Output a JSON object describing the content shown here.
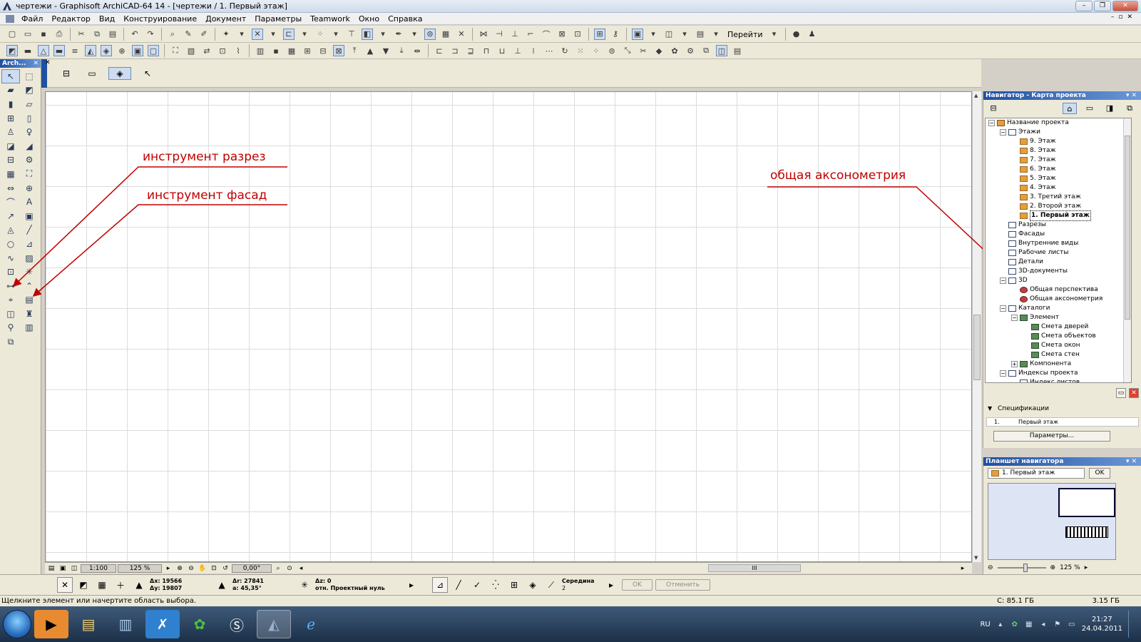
{
  "window": {
    "title": "чертежи - Graphisoft ArchiCAD-64 14 - [чертежи / 1. Первый этаж]",
    "controls": [
      "–",
      "❐",
      "✕"
    ]
  },
  "menu": {
    "items": [
      "Файл",
      "Редактор",
      "Вид",
      "Конструирование",
      "Документ",
      "Параметры",
      "Teamwork",
      "Окно",
      "Справка"
    ]
  },
  "toolbar": {
    "goto_label": "Перейти"
  },
  "toolbox": {
    "title": "Arch...",
    "tools": [
      {
        "name": "arrow-tool",
        "glyph": "↖"
      },
      {
        "name": "marquee-tool",
        "glyph": "⬚"
      },
      {
        "name": "wall-tool",
        "glyph": "▰"
      },
      {
        "name": "beam-tool",
        "glyph": "◩"
      },
      {
        "name": "column-tool",
        "glyph": "▮"
      },
      {
        "name": "slab-tool",
        "glyph": "▱"
      },
      {
        "name": "window-tool",
        "glyph": "⊞"
      },
      {
        "name": "door-tool",
        "glyph": "▯"
      },
      {
        "name": "object-tool",
        "glyph": "♙"
      },
      {
        "name": "lamp-tool",
        "glyph": "♀"
      },
      {
        "name": "roof-tool",
        "glyph": "◪"
      },
      {
        "name": "shell-tool",
        "glyph": "◢"
      },
      {
        "name": "stair-tool",
        "glyph": "⊟"
      },
      {
        "name": "railing-tool",
        "glyph": "⚙"
      },
      {
        "name": "mesh-tool",
        "glyph": "▦"
      },
      {
        "name": "zone-tool",
        "glyph": "⛶"
      },
      {
        "name": "dimension-tool",
        "glyph": "⇔"
      },
      {
        "name": "level-dimension-tool",
        "glyph": "⊕"
      },
      {
        "name": "radial-dimension-tool",
        "glyph": "⌒"
      },
      {
        "name": "text-tool",
        "glyph": "A"
      },
      {
        "name": "label-tool",
        "glyph": "↗"
      },
      {
        "name": "figure-tool",
        "glyph": "▣"
      },
      {
        "name": "fill-tool",
        "glyph": "◬"
      },
      {
        "name": "line-tool",
        "glyph": "╱"
      },
      {
        "name": "circle-tool",
        "glyph": "○"
      },
      {
        "name": "polyline-tool",
        "glyph": "⊿"
      },
      {
        "name": "spline-tool",
        "glyph": "∿"
      },
      {
        "name": "picture-tool",
        "glyph": "▨"
      },
      {
        "name": "detail-tool",
        "glyph": "⊡"
      },
      {
        "name": "hotspot-tool",
        "glyph": "✳"
      },
      {
        "name": "section-tool",
        "glyph": "⊶"
      },
      {
        "name": "elevation-tool",
        "glyph": "⌃"
      },
      {
        "name": "interior-elevation-tool",
        "glyph": "⌖"
      },
      {
        "name": "worksheet-tool",
        "glyph": "▤"
      },
      {
        "name": "change-tool",
        "glyph": "◫"
      },
      {
        "name": "camera-tool",
        "glyph": "♜"
      },
      {
        "name": "camera2-tool",
        "glyph": "⚲"
      },
      {
        "name": "grid-element-tool",
        "glyph": "▥"
      },
      {
        "name": "curtain-wall-tool",
        "glyph": "⧉"
      },
      {
        "name": "",
        "glyph": ""
      }
    ]
  },
  "annotations": {
    "section_tool": "инструмент разрез",
    "elevation_tool": "инструмент фасад",
    "axonometry": "общая аксонометрия"
  },
  "quickbar": {
    "scale": "1:100",
    "zoom": "125 %",
    "angle": "0,00°",
    "hscroll_mark": "III"
  },
  "coords": {
    "dx": "Δx: 19566",
    "dy": "Δy: 19807",
    "dr": "Δr: 27841",
    "a": "a: 45,35°",
    "dz": "Δz: 0",
    "ref": "отн. Проектный нуль",
    "snap_label": "Середина",
    "snap_value": "2",
    "ok": "OK",
    "cancel": "Отменить"
  },
  "status": {
    "message": "Щелкните элемент или начертите область выбора.",
    "disk": "С: 85.1 ГБ",
    "memory": "3.15 ГБ"
  },
  "navigator": {
    "title": "Навигатор - Карта проекта",
    "tree": [
      {
        "label": "Название проекта",
        "level": 0,
        "icon": "house",
        "exp": "−"
      },
      {
        "label": "Этажи",
        "level": 1,
        "icon": "box",
        "exp": "−"
      },
      {
        "label": "9. Этаж",
        "level": 2,
        "icon": "folder",
        "exp": ""
      },
      {
        "label": "8. Этаж",
        "level": 2,
        "icon": "folder",
        "exp": ""
      },
      {
        "label": "7. Этаж",
        "level": 2,
        "icon": "folder",
        "exp": ""
      },
      {
        "label": "6. Этаж",
        "level": 2,
        "icon": "folder",
        "exp": ""
      },
      {
        "label": "5. Этаж",
        "level": 2,
        "icon": "folder",
        "exp": ""
      },
      {
        "label": "4. Этаж",
        "level": 2,
        "icon": "folder",
        "exp": ""
      },
      {
        "label": "3. Третий этаж",
        "level": 2,
        "icon": "folder",
        "exp": ""
      },
      {
        "label": "2. Второй этаж",
        "level": 2,
        "icon": "folder",
        "exp": ""
      },
      {
        "label": "1. Первый этаж",
        "level": 2,
        "icon": "folder",
        "exp": "",
        "selected": true
      },
      {
        "label": "Разрезы",
        "level": 1,
        "icon": "box",
        "exp": ""
      },
      {
        "label": "Фасады",
        "level": 1,
        "icon": "box",
        "exp": ""
      },
      {
        "label": "Внутренние виды",
        "level": 1,
        "icon": "box",
        "exp": ""
      },
      {
        "label": "Рабочие листы",
        "level": 1,
        "icon": "box",
        "exp": ""
      },
      {
        "label": "Детали",
        "level": 1,
        "icon": "box",
        "exp": ""
      },
      {
        "label": "3D-документы",
        "level": 1,
        "icon": "box",
        "exp": ""
      },
      {
        "label": "3D",
        "level": 1,
        "icon": "box",
        "exp": "−"
      },
      {
        "label": "Общая перспектива",
        "level": 2,
        "icon": "sphere",
        "exp": ""
      },
      {
        "label": "Общая аксонометрия",
        "level": 2,
        "icon": "sphere",
        "exp": ""
      },
      {
        "label": "Каталоги",
        "level": 1,
        "icon": "box",
        "exp": "−"
      },
      {
        "label": "Элемент",
        "level": 2,
        "icon": "grid",
        "exp": "−"
      },
      {
        "label": "Смета дверей",
        "level": 3,
        "icon": "grid",
        "exp": ""
      },
      {
        "label": "Смета объектов",
        "level": 3,
        "icon": "grid",
        "exp": ""
      },
      {
        "label": "Смета окон",
        "level": 3,
        "icon": "grid",
        "exp": ""
      },
      {
        "label": "Смета стен",
        "level": 3,
        "icon": "grid",
        "exp": ""
      },
      {
        "label": "Компонента",
        "level": 2,
        "icon": "grid",
        "exp": "+"
      },
      {
        "label": "Индексы проекта",
        "level": 1,
        "icon": "box",
        "exp": "−"
      },
      {
        "label": "Индекс листов",
        "level": 2,
        "icon": "box",
        "exp": ""
      }
    ],
    "spec_title": "Спецификации",
    "spec_num": "1.",
    "spec_name": "Первый этаж",
    "params_button": "Параметры..."
  },
  "preview": {
    "title": "Планшет навигатора",
    "current": "1. Первый этаж",
    "ok": "OK",
    "zoom": "125 %"
  },
  "taskbar": {
    "lang": "RU",
    "time": "21:27",
    "date": "24.04.2011"
  }
}
